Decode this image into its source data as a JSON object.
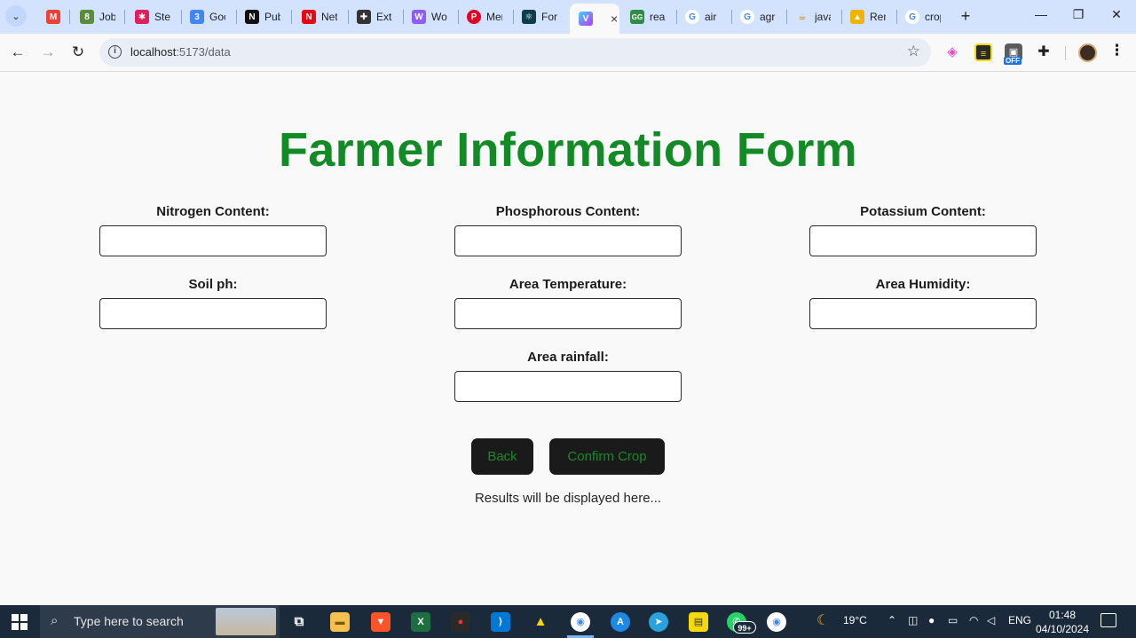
{
  "browser": {
    "tabs": [
      {
        "title": "M",
        "favicon_color": "#ea4335",
        "favicon_glyph": "M"
      },
      {
        "title": "Job",
        "favicon_color": "#5b8c3a",
        "favicon_glyph": "8"
      },
      {
        "title": "Stev",
        "favicon_color": "#e01e5a",
        "favicon_glyph": "✱"
      },
      {
        "title": "Goo",
        "favicon_color": "#4285f4",
        "favicon_glyph": "3"
      },
      {
        "title": "Pub",
        "favicon_color": "#111111",
        "favicon_glyph": "N"
      },
      {
        "title": "Net",
        "favicon_color": "#e50914",
        "favicon_glyph": "N"
      },
      {
        "title": "Exte",
        "favicon_color": "#333333",
        "favicon_glyph": "✚"
      },
      {
        "title": "Wo",
        "favicon_color": "#8f5cf7",
        "favicon_glyph": "W"
      },
      {
        "title": "Mer",
        "favicon_color": "#e60023",
        "favicon_glyph": "P"
      },
      {
        "title": "For",
        "favicon_color": "#0b3d4a",
        "favicon_glyph": "⚛"
      },
      {
        "title": "",
        "favicon_color": "#7b61ff",
        "favicon_glyph": "V"
      },
      {
        "title": "reac",
        "favicon_color": "#2f8d46",
        "favicon_glyph": "GG"
      },
      {
        "title": "air",
        "favicon_color": "#4285f4",
        "favicon_glyph": "G"
      },
      {
        "title": "agr",
        "favicon_color": "#4285f4",
        "favicon_glyph": "G"
      },
      {
        "title": "java",
        "favicon_color": "#e76f00",
        "favicon_glyph": "☕"
      },
      {
        "title": "Ren",
        "favicon_color": "#f0b400",
        "favicon_glyph": "🎓"
      },
      {
        "title": "crop",
        "favicon_color": "#4285f4",
        "favicon_glyph": "G"
      }
    ],
    "active_tab_close": "×",
    "new_tab": "+",
    "window_controls": {
      "minimize": "—",
      "restore": "❐",
      "close": "✕"
    },
    "nav": {
      "back": "←",
      "forward": "→",
      "reload": "↻"
    },
    "address": {
      "host": "localhost",
      "path": ":5173/data"
    },
    "star_icon": "☆",
    "extensions": {
      "off_badge": "OFF"
    },
    "menu_icon": "⋮"
  },
  "form": {
    "title": "Farmer Information Form",
    "fields": {
      "nitrogen": {
        "label": "Nitrogen Content:",
        "value": ""
      },
      "phosphorous": {
        "label": "Phosphorous Content:",
        "value": ""
      },
      "potassium": {
        "label": "Potassium Content:",
        "value": ""
      },
      "soil_ph": {
        "label": "Soil ph:",
        "value": ""
      },
      "temperature": {
        "label": "Area Temperature:",
        "value": ""
      },
      "humidity": {
        "label": "Area Humidity:",
        "value": ""
      },
      "rainfall": {
        "label": "Area rainfall:",
        "value": ""
      }
    },
    "back_label": "Back",
    "confirm_label": "Confirm Crop",
    "results_text": "Results will be displayed here..."
  },
  "taskbar": {
    "search_placeholder": "Type here to search",
    "weather": "19°C",
    "language": "ENG",
    "time": "01:48",
    "date": "04/10/2024",
    "whatsapp_badge": "99+"
  }
}
